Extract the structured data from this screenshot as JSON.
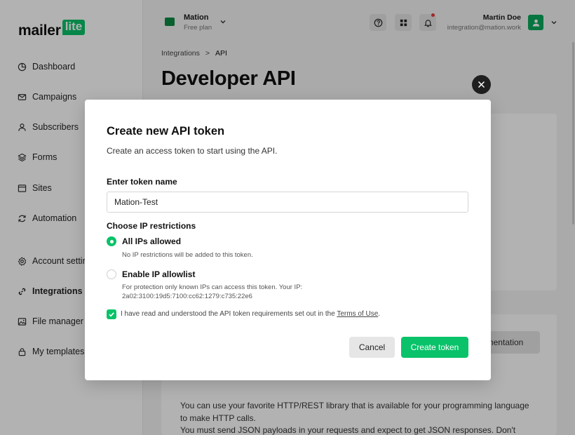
{
  "brand": {
    "logo_main": "mailer",
    "logo_badge": "lite",
    "accent": "#09c269"
  },
  "sidebar": {
    "items": [
      {
        "label": "Dashboard",
        "icon": "dashboard-icon"
      },
      {
        "label": "Campaigns",
        "icon": "mail-icon"
      },
      {
        "label": "Subscribers",
        "icon": "user-icon"
      },
      {
        "label": "Forms",
        "icon": "layers-icon"
      },
      {
        "label": "Sites",
        "icon": "browser-icon"
      },
      {
        "label": "Automation",
        "icon": "refresh-icon"
      },
      {
        "label": "Account settings",
        "icon": "gear-icon"
      },
      {
        "label": "Integrations",
        "icon": "link-icon",
        "active": true
      },
      {
        "label": "File manager",
        "icon": "image-icon"
      },
      {
        "label": "My templates",
        "icon": "lock-icon"
      }
    ]
  },
  "header": {
    "account_name": "Mation",
    "account_plan": "Free plan",
    "user_name": "Martin Doe",
    "user_email": "integration@mation.work"
  },
  "page": {
    "breadcrumb": [
      "Integrations",
      ">",
      "API"
    ],
    "title": "Developer API",
    "documentation_button": "mentation",
    "intro_text": "You can use your favorite HTTP/REST library that is available for your programming language to make HTTP calls.\nYou must send JSON payloads in your requests and expect to get JSON responses. Don't"
  },
  "modal": {
    "title": "Create new API token",
    "description": "Create an access token to start using the API.",
    "token_label": "Enter token name",
    "token_value": "Mation-Test",
    "ip_label": "Choose IP restrictions",
    "option_all": {
      "title": "All IPs allowed",
      "help": "No IP restrictions will be added to this token.",
      "selected": true
    },
    "option_allowlist": {
      "title": "Enable IP allowlist",
      "help": "For protection only known IPs can access this token. Your IP:",
      "ip": "2a02:3100:19d5:7100:cc62:1279:c735:22e6",
      "selected": false
    },
    "terms_text": "I have read and understood the API token requirements set out in the ",
    "terms_link": "Terms of Use",
    "terms_end": ".",
    "terms_checked": true,
    "cancel_label": "Cancel",
    "create_label": "Create token"
  }
}
